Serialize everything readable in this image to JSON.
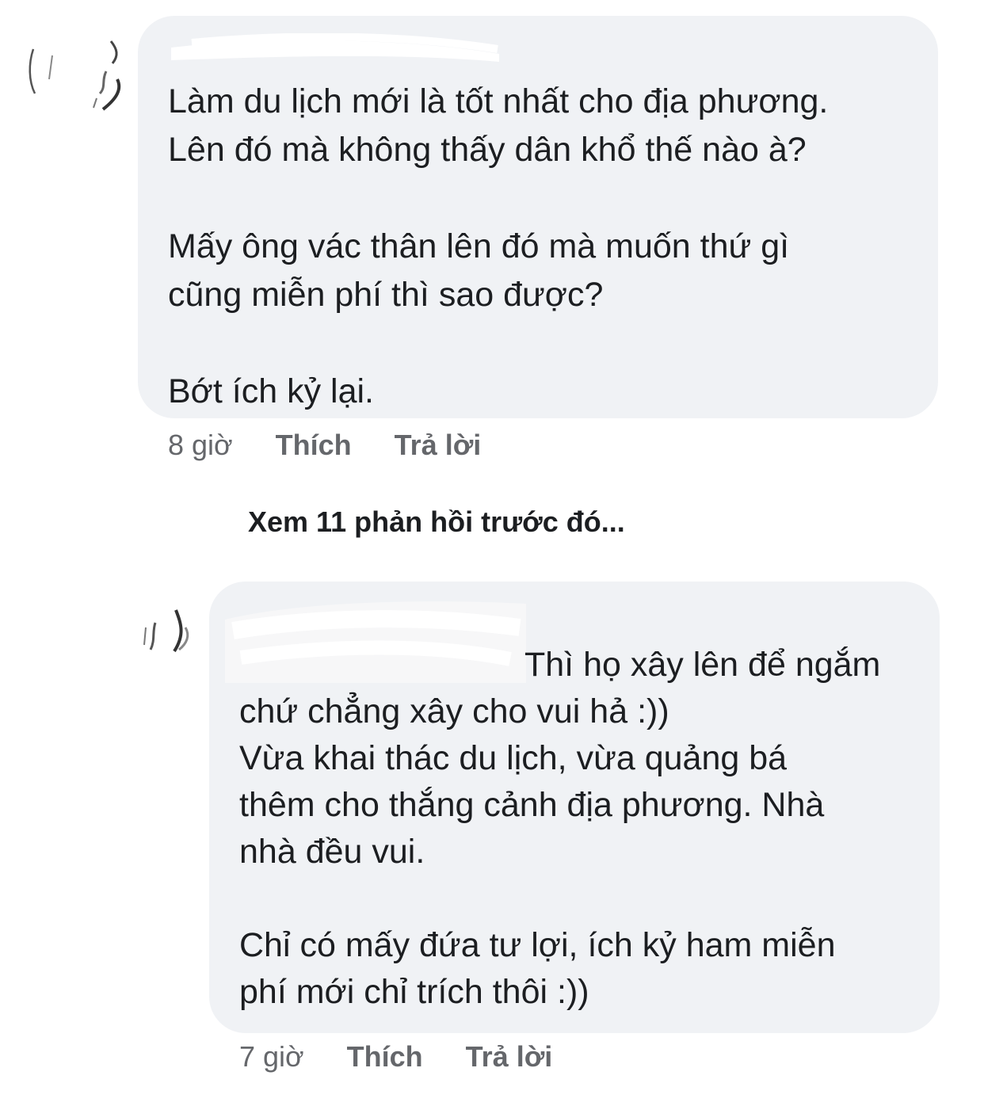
{
  "comments": [
    {
      "lines": [
        "Làm du lịch mới là tốt nhất cho địa phương.",
        "Lên đó mà không thấy dân khổ thế nào à?",
        "",
        "Mấy ông vác thân lên đó mà muốn thứ gì",
        "cũng miễn phí thì sao được?",
        "",
        "Bớt ích kỷ lại."
      ],
      "time": "8 giờ",
      "like_label": "Thích",
      "reply_label": "Trả lời"
    },
    {
      "first_line_text": "Thì họ xây lên để ngắm",
      "lines": [
        "chứ chẳng xây cho vui hả :))",
        "Vừa khai thác du lịch, vừa quảng bá",
        "thêm cho thắng cảnh địa phương. Nhà",
        "nhà đều vui.",
        "",
        "Chỉ có mấy đứa tư lợi, ích kỷ ham miễn",
        "phí mới chỉ trích thôi :))"
      ],
      "time": "7 giờ",
      "like_label": "Thích",
      "reply_label": "Trả lời"
    }
  ],
  "view_previous_replies": "Xem 11 phản hồi trước đó...",
  "colors": {
    "bubble_bg": "#f0f2f5",
    "text": "#1c1e21",
    "meta_text": "#65676b",
    "redaction": "#ffffff"
  },
  "icons": {
    "avatar_1": "avatar-partial",
    "avatar_2": "avatar-partial"
  }
}
